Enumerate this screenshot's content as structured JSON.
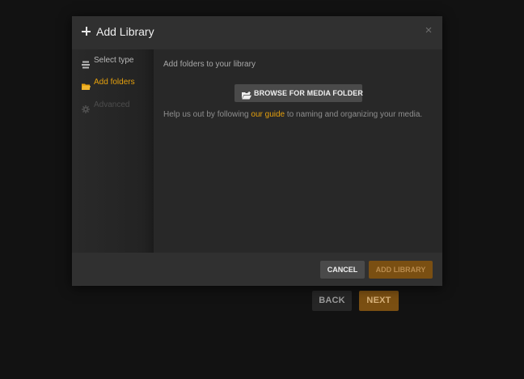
{
  "background_wizard": {
    "back_label": "BACK",
    "next_label": "NEXT"
  },
  "modal": {
    "title": "Add Library",
    "close_glyph": "×",
    "sidebar": {
      "items": [
        {
          "label": "Select type",
          "icon": "stack-icon",
          "state": "visited"
        },
        {
          "label": "Add folders",
          "icon": "folder-icon",
          "state": "active"
        },
        {
          "label": "Advanced",
          "icon": "gear-icon",
          "state": "disabled"
        }
      ]
    },
    "pane": {
      "heading": "Add folders to your library",
      "browse_label": "BROWSE FOR MEDIA FOLDER",
      "help_before": "Help us out by following ",
      "help_link": "our guide",
      "help_after": " to naming and organizing your media."
    },
    "footer": {
      "cancel_label": "CANCEL",
      "add_label": "ADD LIBRARY"
    }
  },
  "colors": {
    "accent": "#e5a00d",
    "accent_dark": "#7a4f12",
    "modal_bg": "#282828",
    "header_bg": "#303030",
    "page_bg": "#121212"
  }
}
